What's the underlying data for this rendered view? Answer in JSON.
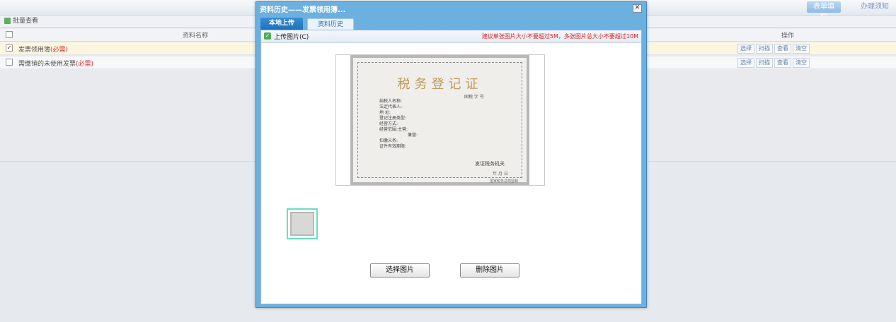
{
  "topbar": {
    "tab_form": "表单填写",
    "tab_notice": "办理须知"
  },
  "section": {
    "title": "批量查看"
  },
  "table": {
    "col_name": "资料名称",
    "col_ops": "操作",
    "rows": [
      {
        "name": "发票领用簿",
        "required": "(必需)"
      },
      {
        "name": "需缴销的未使用发票",
        "required": "(必需)"
      }
    ],
    "row_actions": [
      "选择",
      "扫描",
      "查看",
      "清空"
    ]
  },
  "modal": {
    "title": "资料历史——发票领用簿...",
    "close_symbol": "✕",
    "tabs": [
      "本地上传",
      "资料历史"
    ],
    "upload_label": "上传图片(C)",
    "size_warning": "建议单张图片大小不要超过5M，多张图片总大小不要超过10M",
    "preview": {
      "cert_title": "税务登记证",
      "cert_no": "国税 字 号",
      "fields": [
        "纳税人名称:",
        "法定代表人:",
        "地 址:",
        "登记注册类型:",
        "经营方式:",
        "经营范围:主营:",
        "兼营:",
        "扣缴义务:",
        "证件有效期限:"
      ],
      "issuer": "发证税务机关",
      "date": "年 月 日",
      "footer": "国家税务总局监制"
    },
    "choose_button": "选择图片",
    "delete_button": "删除图片"
  },
  "colors": {
    "modal_border": "#3e86c6",
    "active_tab": "#1f6fba",
    "warning": "#e21b1b",
    "required": "#dd3333",
    "thumb_highlight": "#66e0c0"
  }
}
